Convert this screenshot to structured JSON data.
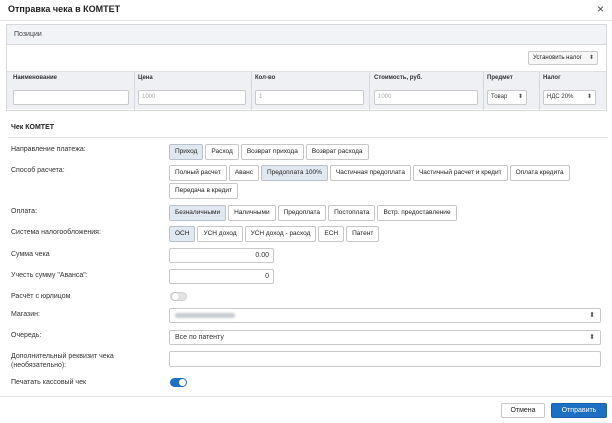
{
  "dialog": {
    "title": "Отправка чека в КОМТЕТ",
    "close_icon": "close-icon"
  },
  "positions": {
    "header": "Позиции",
    "set_tax_button": "Установить налог",
    "columns": [
      "Наименование",
      "Цена",
      "Кол-во",
      "Стоимость, руб.",
      "Предмет",
      "Налог"
    ],
    "row": {
      "name": "",
      "price_placeholder": "1000",
      "qty_placeholder": "1",
      "cost_placeholder": "1000",
      "subject": "Товар",
      "tax": "НДС 20%"
    }
  },
  "check": {
    "section_title": "Чек КОМТЕТ",
    "direction": {
      "label": "Направление платежа:",
      "options": [
        "Приход",
        "Расход",
        "Возврат прихода",
        "Возврат расхода"
      ],
      "selected": 0
    },
    "calc_method": {
      "label": "Способ расчета:",
      "options": [
        "Полный расчет",
        "Аванс",
        "Предоплата 100%",
        "Частичная предоплата",
        "Частичный расчет и кредит",
        "Оплата кредита",
        "Передача в кредит"
      ],
      "selected": 2
    },
    "payment": {
      "label": "Оплата:",
      "options": [
        "Безналичными",
        "Наличными",
        "Предоплата",
        "Постоплата",
        "Встр. предоставление"
      ],
      "selected": 0
    },
    "tax_system": {
      "label": "Система налогообложения:",
      "options": [
        "ОСН",
        "УСН доход",
        "УСН доход - расход",
        "ЕСН",
        "Патент"
      ],
      "selected": 0
    },
    "sum": {
      "label": "Сумма чека",
      "value": "0.00"
    },
    "advance": {
      "label": "Учесть сумму \"Аванса\":",
      "value": "0"
    },
    "legal_entity": {
      "label": "Расчёт с юрлицом",
      "on": false
    },
    "shop": {
      "label": "Магазин:"
    },
    "queue": {
      "label": "Очередь:",
      "value": "Все по патенту"
    },
    "extra": {
      "label_line1": "Дополнительный реквизит чека",
      "label_line2": "(необязательно):"
    },
    "print": {
      "label": "Печатать кассовый чек",
      "on": true
    }
  },
  "footer": {
    "cancel": "Отмена",
    "send": "Отправить"
  },
  "colors": {
    "accent": "#1d6fc4",
    "active_option": "#e2e8ef"
  }
}
